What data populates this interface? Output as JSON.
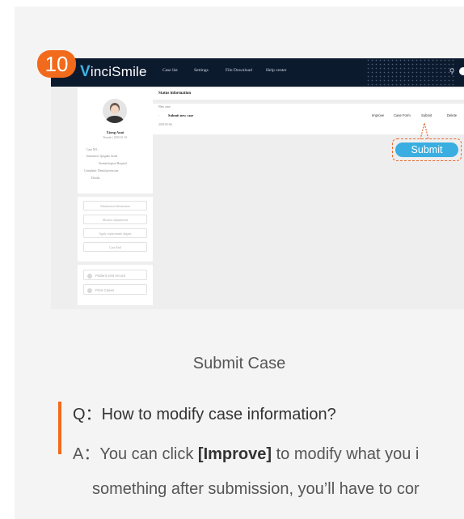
{
  "step_badge": "10",
  "app": {
    "logo_v": "V",
    "logo_rest": "inciSmile",
    "nav": [
      "Case list",
      "Settings",
      "File Download",
      "Help center"
    ]
  },
  "patient": {
    "name": "Xiong Anni",
    "dob": "Female | 2000-01-01",
    "case_no": "Case NO.:",
    "institution": "Institution: Qingdao Stoda",
    "hospital": "Stomatological Hospital",
    "complaint": "Complaint: Dental protrusion",
    "details": "Details:"
  },
  "sidebar_buttons": [
    "Submission Information",
    "Monitor adjustments",
    "Apply replacement aligner",
    "Case End"
  ],
  "link_buttons": [
    "Patient visit record",
    "Print Cases"
  ],
  "status": {
    "heading": "Status information",
    "new_case": "New case",
    "action": "Submit new case",
    "date": "2019-05-06",
    "buttons": [
      "Improve",
      "Case Form",
      "Submit",
      "Delete"
    ]
  },
  "highlight_button": "Submit",
  "caption": "Submit Case",
  "qa": {
    "q_prefix": "Q：",
    "question": "How to modify case information?",
    "a_prefix": "A：",
    "a_part1": "You can click ",
    "a_bold": "[Improve]",
    "a_part2": " to modify what you i",
    "a_line2": "something after submission, you’ll have to cor"
  },
  "colors": {
    "accent_orange": "#f26a1b",
    "submit_blue": "#3aaee0",
    "topbar": "#0c1a2e"
  }
}
